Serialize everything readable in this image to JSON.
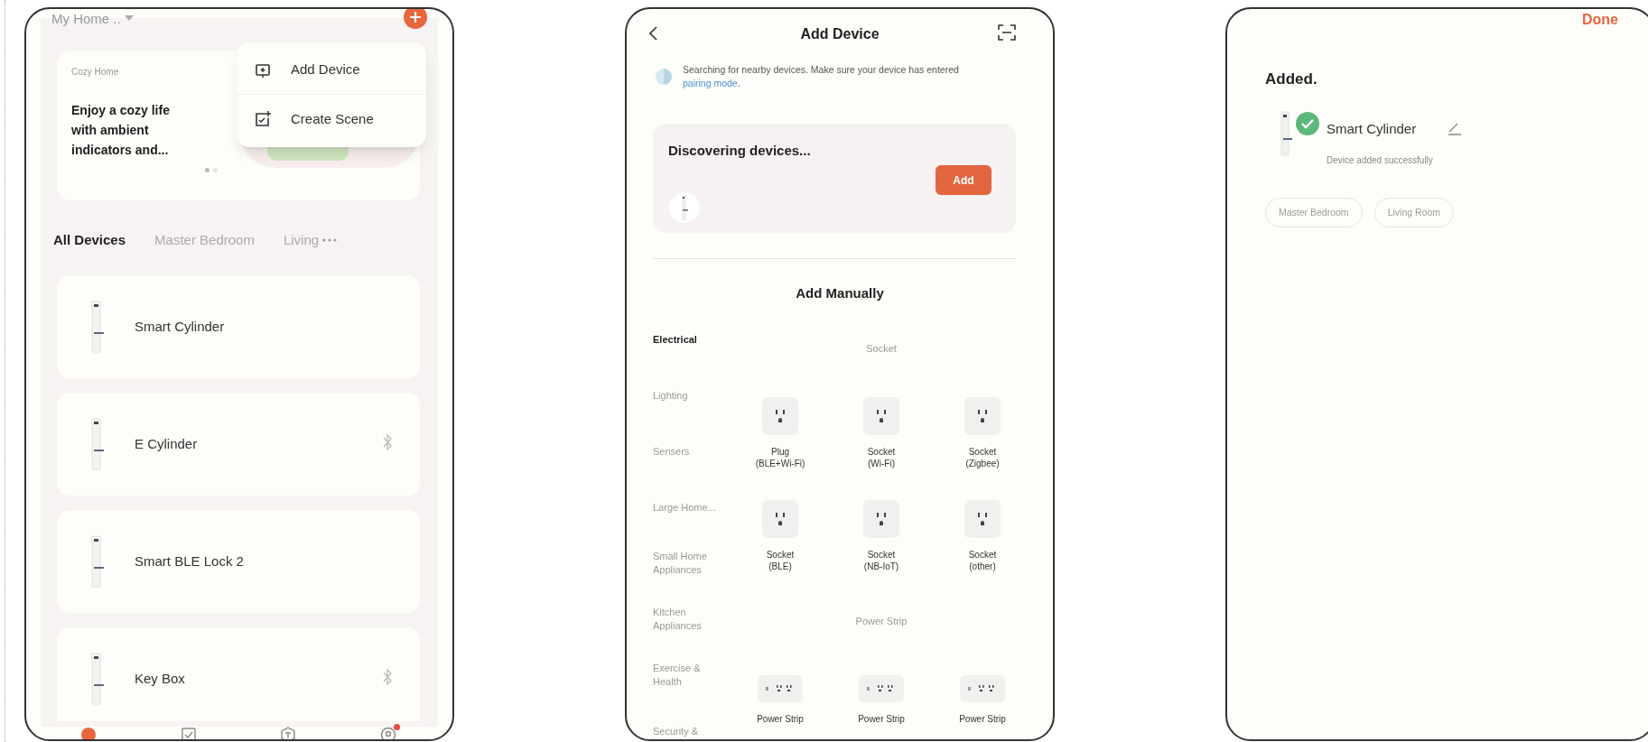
{
  "home_screen": {
    "home_selector": "My Home ..",
    "menu": [
      {
        "kind": "device",
        "label": "Add Device"
      },
      {
        "kind": "scene",
        "label": "Create Scene"
      }
    ],
    "banner": {
      "eyebrow": "Cozy Home",
      "headline": "Enjoy a cozy life with ambient indicators and...",
      "pages": [
        {
          "selected": true
        },
        {
          "selected": false
        }
      ]
    },
    "room_tabs": [
      {
        "label": "All Devices",
        "selected": true
      },
      {
        "label": "Master Bedroom",
        "selected": false
      },
      {
        "label": "Living",
        "selected": false
      }
    ],
    "devices": [
      {
        "name": "Smart Cylinder",
        "bluetooth": false
      },
      {
        "name": "E Cylinder",
        "bluetooth": true
      },
      {
        "name": "Smart BLE Lock 2",
        "bluetooth": false
      },
      {
        "name": "Key Box",
        "bluetooth": true
      }
    ],
    "nav": [
      {
        "kind": "home",
        "selected": true,
        "badge": false
      },
      {
        "kind": "scene",
        "selected": false,
        "badge": false
      },
      {
        "kind": "smart",
        "selected": false,
        "badge": false
      },
      {
        "kind": "me",
        "selected": false,
        "badge": true
      }
    ]
  },
  "add_device_screen": {
    "title": "Add Device",
    "searching": {
      "text": "Searching for nearby devices. Make sure your device has entered",
      "link": "pairing mode",
      "tail": "."
    },
    "discovering": {
      "title": "Discovering devices...",
      "button": "Add"
    },
    "manual_title": "Add Manually",
    "categories": [
      {
        "label": "Electrical",
        "selected": true
      },
      {
        "label": "Lighting",
        "selected": false
      },
      {
        "label": "Sensers",
        "selected": false
      },
      {
        "label": "Large Home...",
        "selected": false
      },
      {
        "label": "Small Home Appliances",
        "selected": false
      },
      {
        "label": "Kitchen Appliances",
        "selected": false
      },
      {
        "label": "Exercise & Health",
        "selected": false
      },
      {
        "label": "Security &",
        "selected": false
      }
    ],
    "groups": [
      {
        "title": "Socket",
        "items": [
          {
            "kind": "socket",
            "name": "Plug",
            "variant": "(BLE+Wi-Fi)"
          },
          {
            "kind": "socket",
            "name": "Socket",
            "variant": "(Wi-Fi)"
          },
          {
            "kind": "socket",
            "name": "Socket",
            "variant": "(Zigbee)"
          },
          {
            "kind": "socket",
            "name": "Socket",
            "variant": "(BLE)"
          },
          {
            "kind": "socket",
            "name": "Socket",
            "variant": "(NB-IoT)"
          },
          {
            "kind": "socket",
            "name": "Socket",
            "variant": "(other)"
          }
        ]
      },
      {
        "title": "Power Strip",
        "items": [
          {
            "kind": "strip",
            "name": "Power Strip"
          },
          {
            "kind": "strip",
            "name": "Power Strip"
          },
          {
            "kind": "strip",
            "name": "Power Strip"
          }
        ]
      }
    ]
  },
  "added_screen": {
    "done": "Done",
    "title": "Added.",
    "device": {
      "name": "Smart Cylinder",
      "status": "Device added successfully"
    },
    "rooms": [
      {
        "label": "Master Bedroom",
        "selected": false
      },
      {
        "label": "Living Room",
        "selected": false
      }
    ]
  }
}
